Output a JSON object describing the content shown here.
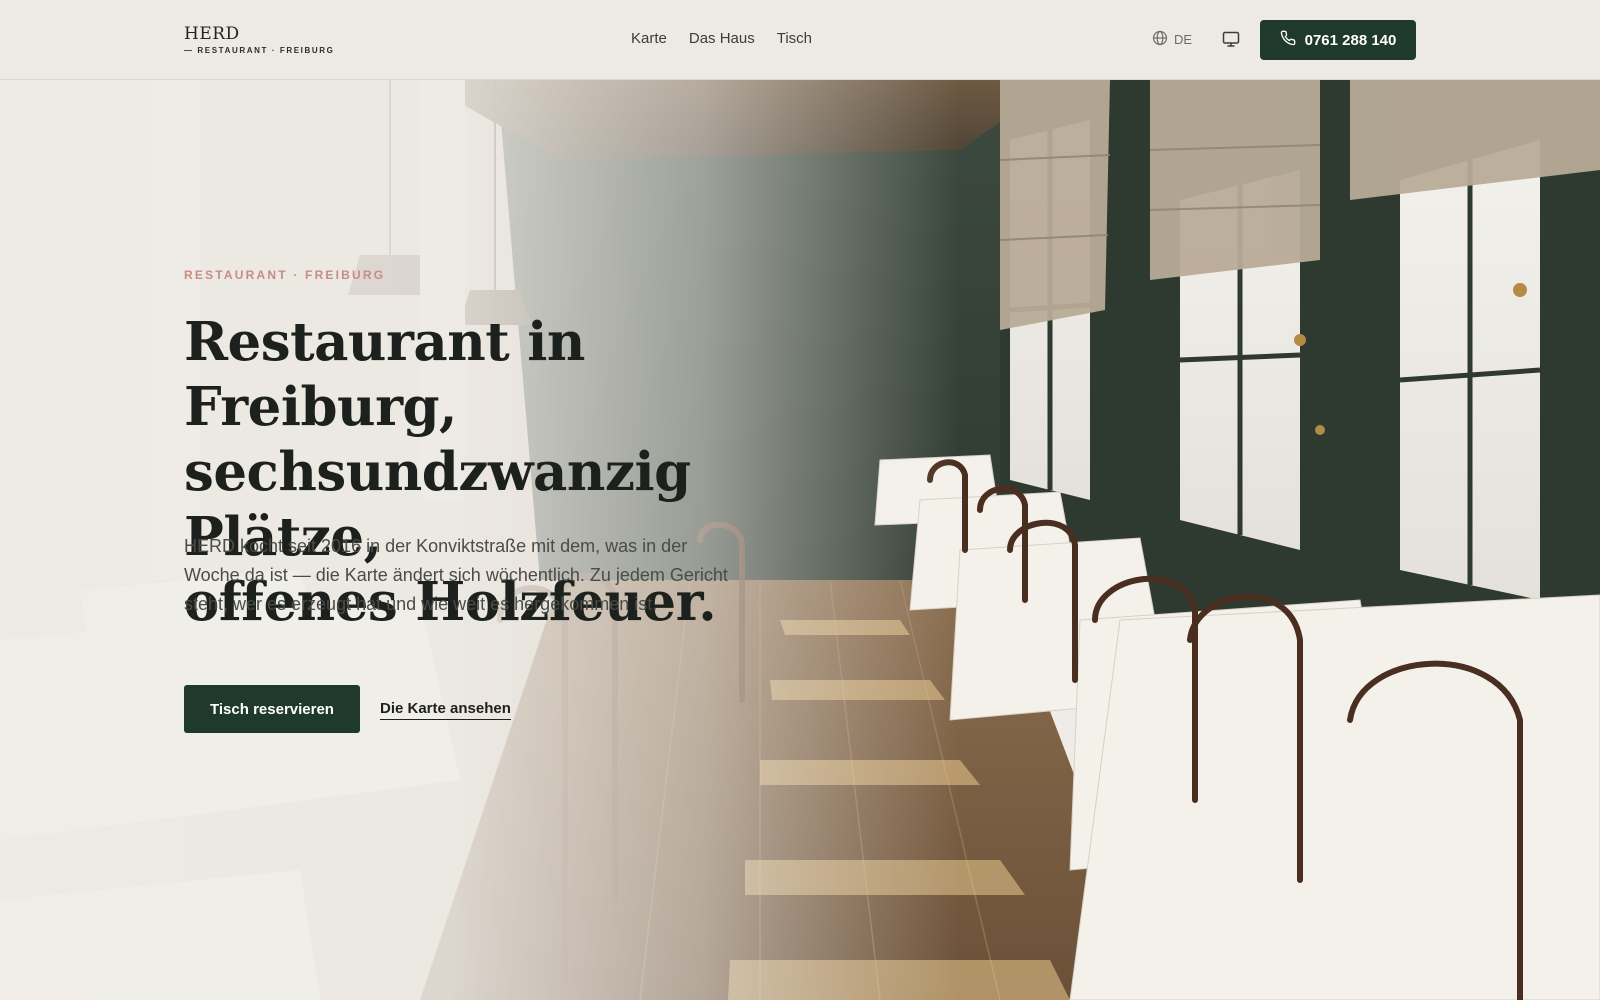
{
  "header": {
    "logo": "HERD",
    "logo_sub": "— RESTAURANT · FREIBURG",
    "nav": [
      {
        "label": "Karte"
      },
      {
        "label": "Das Haus"
      },
      {
        "label": "Tisch"
      }
    ],
    "language": "DE",
    "phone": "0761 288 140"
  },
  "hero": {
    "eyebrow": "RESTAURANT · FREIBURG",
    "headline_lines": [
      "Restaurant in Freiburg,",
      "sechsundzwanzig Plätze,",
      "offenes Holzfeuer."
    ],
    "lead": "HERD kocht seit 2016 in der Konviktstraße mit dem, was in der Woche da ist — die Karte ändert sich wöchentlich. Zu jedem Gericht steht, wer es erzeugt hat und wie weit es hergekommen ist.",
    "cta_primary": "Tisch reservieren",
    "cta_secondary": "Die Karte ansehen"
  },
  "icons": {
    "globe": "globe-icon",
    "display": "monitor-icon",
    "phone": "phone-icon"
  },
  "colors": {
    "accent_green": "#1f3a2c",
    "eyebrow_pink": "#c98b87",
    "background": "#efece7"
  }
}
